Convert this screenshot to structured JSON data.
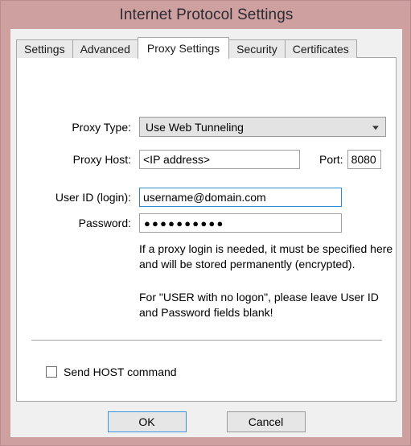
{
  "window": {
    "title": "Internet Protocol Settings",
    "frame_color": "#cfa0a0",
    "body_color": "#f0f0f0"
  },
  "tabs": [
    {
      "label": "Settings",
      "active": false
    },
    {
      "label": "Advanced",
      "active": false
    },
    {
      "label": "Proxy Settings",
      "active": true
    },
    {
      "label": "Security",
      "active": false
    },
    {
      "label": "Certificates",
      "active": false
    }
  ],
  "form": {
    "proxy_type": {
      "label": "Proxy Type:",
      "value": "Use Web Tunneling",
      "arrow_icon": "chevron-down-icon"
    },
    "proxy_host": {
      "label": "Proxy Host:",
      "value": "<IP address>"
    },
    "port": {
      "label": "Port:",
      "value": "8080"
    },
    "user_id": {
      "label": "User ID (login):",
      "value": "username@domain.com",
      "focused": true,
      "focus_color": "#2f8ad4"
    },
    "password": {
      "label": "Password:",
      "value": "●●●●●●●●●●",
      "masked_length": 10
    }
  },
  "help": {
    "paragraph_1": "If a proxy login is needed, it must be specified here and will be stored permanently (encrypted).",
    "paragraph_2": "For \"USER with no logon\", please leave User ID and Password fields blank!"
  },
  "options": {
    "send_host": {
      "label": "Send HOST command",
      "checked": false
    }
  },
  "buttons": {
    "ok": "OK",
    "cancel": "Cancel",
    "default_button": "ok",
    "default_border_color": "#3a94de"
  }
}
